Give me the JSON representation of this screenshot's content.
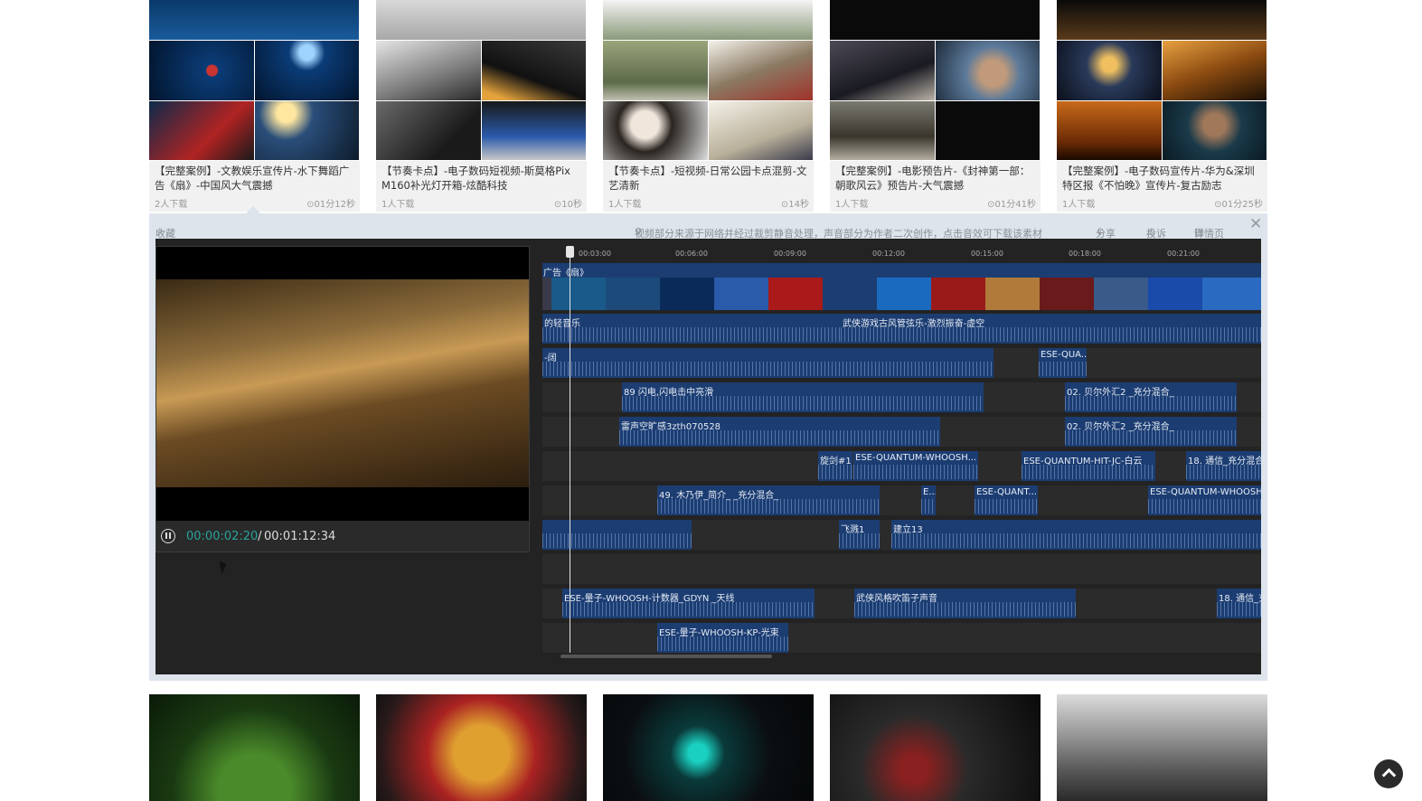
{
  "cards": [
    {
      "title": "【完整案例】-文教娱乐宣传片-水下舞蹈广告《扇》-中国风大气震撼",
      "downloads": "2人下载",
      "duration": "01分12秒"
    },
    {
      "title": "【节奏卡点】-电子数码短视频-斯莫格Pix M160补光灯开箱-炫酷科技",
      "downloads": "1人下载",
      "duration": "10秒"
    },
    {
      "title": "【节奏卡点】-短视频-日常公园卡点混剪-文艺清新",
      "downloads": "1人下载",
      "duration": "14秒"
    },
    {
      "title": "【完整案例】-电影预告片-《封神第一部：朝歌风云》预告片-大气震撼",
      "downloads": "1人下载",
      "duration": "01分41秒"
    },
    {
      "title": "【完整案例】-电子数码宣传片-华为&深圳特区报《不怕晚》宣传片-复古励志",
      "downloads": "1人下载",
      "duration": "01分25秒"
    }
  ],
  "toolbar": {
    "favorite": "收藏",
    "notice": "视频部分来源于网络并经过裁剪静音处理，声音部分为作者二次创作，点击音效可下载该素材",
    "share": "分享",
    "report": "投诉",
    "detail": "详情页"
  },
  "player": {
    "current": "00:00:02:20",
    "separator": " / ",
    "total": "00:01:12:34"
  },
  "ruler_ticks": [
    "00:03:00",
    "00:06:00",
    "00:09:00",
    "00:12:00",
    "00:15:00",
    "00:18:00",
    "00:21:00"
  ],
  "tracks": [
    {
      "clips": [
        {
          "label": "的轻音乐"
        },
        {
          "label": "武侠游戏古风管弦乐-激烈振奋-虚空"
        }
      ]
    },
    {
      "clips": [
        {
          "label": "-阔"
        },
        {
          "label": "ESE-QUA..."
        }
      ]
    },
    {
      "clips": [
        {
          "label": "89 闪电,闪电击中亮滑"
        },
        {
          "label": "02. 贝尔外汇2 _充分混合_"
        }
      ]
    },
    {
      "clips": [
        {
          "label": "雷声空旷感3zth070528"
        },
        {
          "label": "02. 贝尔外汇2 _充分混合_"
        }
      ]
    },
    {
      "clips": [
        {
          "label": "旋剑#1"
        },
        {
          "label": "ESE-QUANTUM-WHOOSH..."
        },
        {
          "label": "ESE-QUANTUM-HIT-JC-白云"
        },
        {
          "label": "18. 通信_充分混合"
        }
      ]
    },
    {
      "clips": [
        {
          "label": "49. 木乃伊_简介_ _充分混合_"
        },
        {
          "label": "E..."
        },
        {
          "label": "ESE-QUANT..."
        },
        {
          "label": "ESE-QUANTUM-WHOOSH"
        }
      ]
    },
    {
      "clips": [
        {
          "label": ""
        },
        {
          "label": "飞溅1"
        },
        {
          "label": "建立13"
        }
      ]
    },
    {
      "clips": []
    },
    {
      "clips": [
        {
          "label": "ESE-量子-WHOOSH-计数器_GDYN _天线"
        },
        {
          "label": "武侠风格吹笛子声音"
        },
        {
          "label": "18. 通信_充"
        }
      ]
    },
    {
      "clips": [
        {
          "label": "ESE-量子-WHOOSH-KP-光束"
        }
      ]
    }
  ],
  "video_track_label": "广告《扇》",
  "colors": {
    "clip": "#1c3d72",
    "time_current": "#2aa39a",
    "editor_bg": "#232323"
  }
}
